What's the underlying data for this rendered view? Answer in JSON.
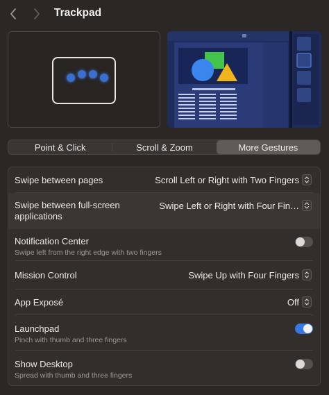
{
  "window": {
    "title": "Trackpad"
  },
  "tabs": {
    "items": [
      {
        "label": "Point & Click",
        "selected": false
      },
      {
        "label": "Scroll & Zoom",
        "selected": false
      },
      {
        "label": "More Gestures",
        "selected": true
      }
    ]
  },
  "settings": {
    "swipe_pages": {
      "title": "Swipe between pages",
      "value": "Scroll Left or Right with Two Fingers"
    },
    "swipe_fullscreen": {
      "title_line1": "Swipe between full-screen",
      "title_line2": "applications",
      "value": "Swipe Left or Right with Four Fin…"
    },
    "notification_center": {
      "title": "Notification Center",
      "subtitle": "Swipe left from the right edge with two fingers",
      "enabled": false
    },
    "mission_control": {
      "title": "Mission Control",
      "value": "Swipe Up with Four Fingers"
    },
    "app_expose": {
      "title": "App Exposé",
      "value": "Off"
    },
    "launchpad": {
      "title": "Launchpad",
      "subtitle": "Pinch with thumb and three fingers",
      "enabled": true
    },
    "show_desktop": {
      "title": "Show Desktop",
      "subtitle": "Spread with thumb and three fingers",
      "enabled": false
    }
  },
  "colors": {
    "accent": "#3478e4",
    "background": "#2a2725",
    "gesture_dot": "#3b6fcf"
  },
  "icons": {
    "back": "chevron-left-icon",
    "forward": "chevron-right-icon",
    "popup": "up-down-chevron-icon"
  }
}
